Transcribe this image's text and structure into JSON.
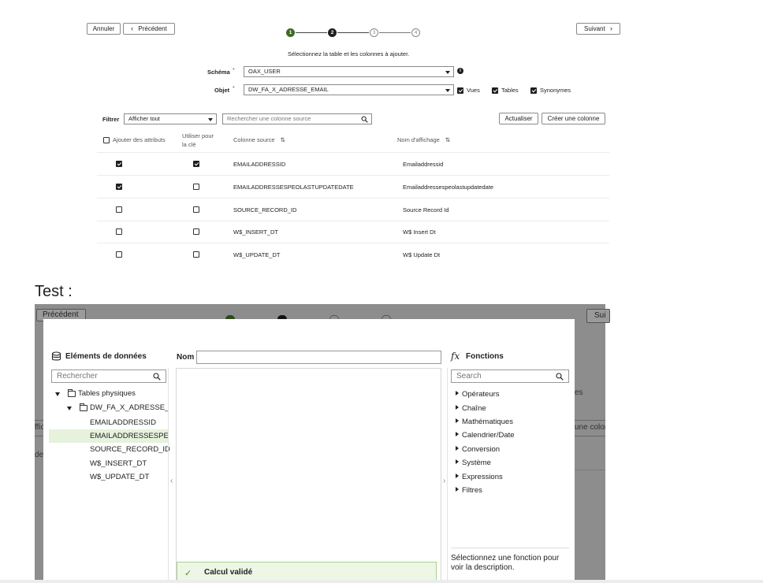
{
  "wizard": {
    "cancel_label": "Annuler",
    "prev_label": "Précédent",
    "next_label": "Suivant",
    "steps": [
      "1",
      "2",
      "3",
      "4"
    ],
    "subtitle": "Sélectionnez la table et les colonnes à ajouter."
  },
  "form": {
    "schema_label": "Schéma",
    "schema_value": "OAX_USER",
    "object_label": "Objet",
    "object_value": "DW_FA_X_ADRESSE_EMAIL",
    "required_mark": "*",
    "info_icon": "i",
    "opt_views": "Vues",
    "opt_tables": "Tables",
    "opt_synonyms": "Synonymes"
  },
  "filter": {
    "label": "Filtrer",
    "value": "Afficher tout",
    "search_placeholder": "Rechercher une colonne source",
    "refresh_label": "Actualiser",
    "create_label": "Créer une colonne"
  },
  "table": {
    "header_add_attrs": "Ajouter des attributs",
    "header_use_key_1": "Utiliser pour",
    "header_use_key_2": "la clé",
    "header_source": "Colonne source",
    "header_display": "Nom d'affichage",
    "sort_icon": "⇅",
    "rows": [
      {
        "add": true,
        "key": true,
        "source": "EMAILADDRESSID",
        "display": "Emailaddressid"
      },
      {
        "add": true,
        "key": false,
        "source": "EMAILADDRESSESPEOLASTUPDATEDATE",
        "display": "Emailaddressespeolastupdatedate"
      },
      {
        "add": false,
        "key": false,
        "source": "SOURCE_RECORD_ID",
        "display": "Source Record Id"
      },
      {
        "add": false,
        "key": false,
        "source": "W$_INSERT_DT",
        "display": "W$ Insert Dt"
      },
      {
        "add": false,
        "key": false,
        "source": "W$_UPDATE_DT",
        "display": "W$ Update Dt"
      }
    ]
  },
  "test_label": "Test :",
  "background": {
    "prev_label": "Précédent",
    "next_fragment": "Sui",
    "frag_es": "es",
    "frag_ffic": "ffic",
    "frag_une_colon": "une colon",
    "frag_de": "de"
  },
  "dialog": {
    "data_panel_title": "Eléments de données",
    "data_search_placeholder": "Rechercher",
    "tree": {
      "root": "Tables physiques",
      "table": "DW_FA_X_ADRESSE_EM",
      "columns": [
        "EMAILADDRESSID",
        "EMAILADDRESSESPEOL",
        "SOURCE_RECORD_ID",
        "W$_INSERT_DT",
        "W$_UPDATE_DT"
      ]
    },
    "name_label": "Nom",
    "name_value": "",
    "collapse_left": "‹",
    "collapse_right": "›",
    "fx_glyph": "fx",
    "functions_title": "Fonctions",
    "fn_search_placeholder": "Search",
    "functions": [
      "Opérateurs",
      "Chaîne",
      "Mathématiques",
      "Calendrier/Date",
      "Conversion",
      "Système",
      "Expressions",
      "Filtres"
    ],
    "fn_description": "Sélectionnez une fonction pour voir la description.",
    "validation_label": "Calcul validé",
    "check_glyph": "✓"
  }
}
